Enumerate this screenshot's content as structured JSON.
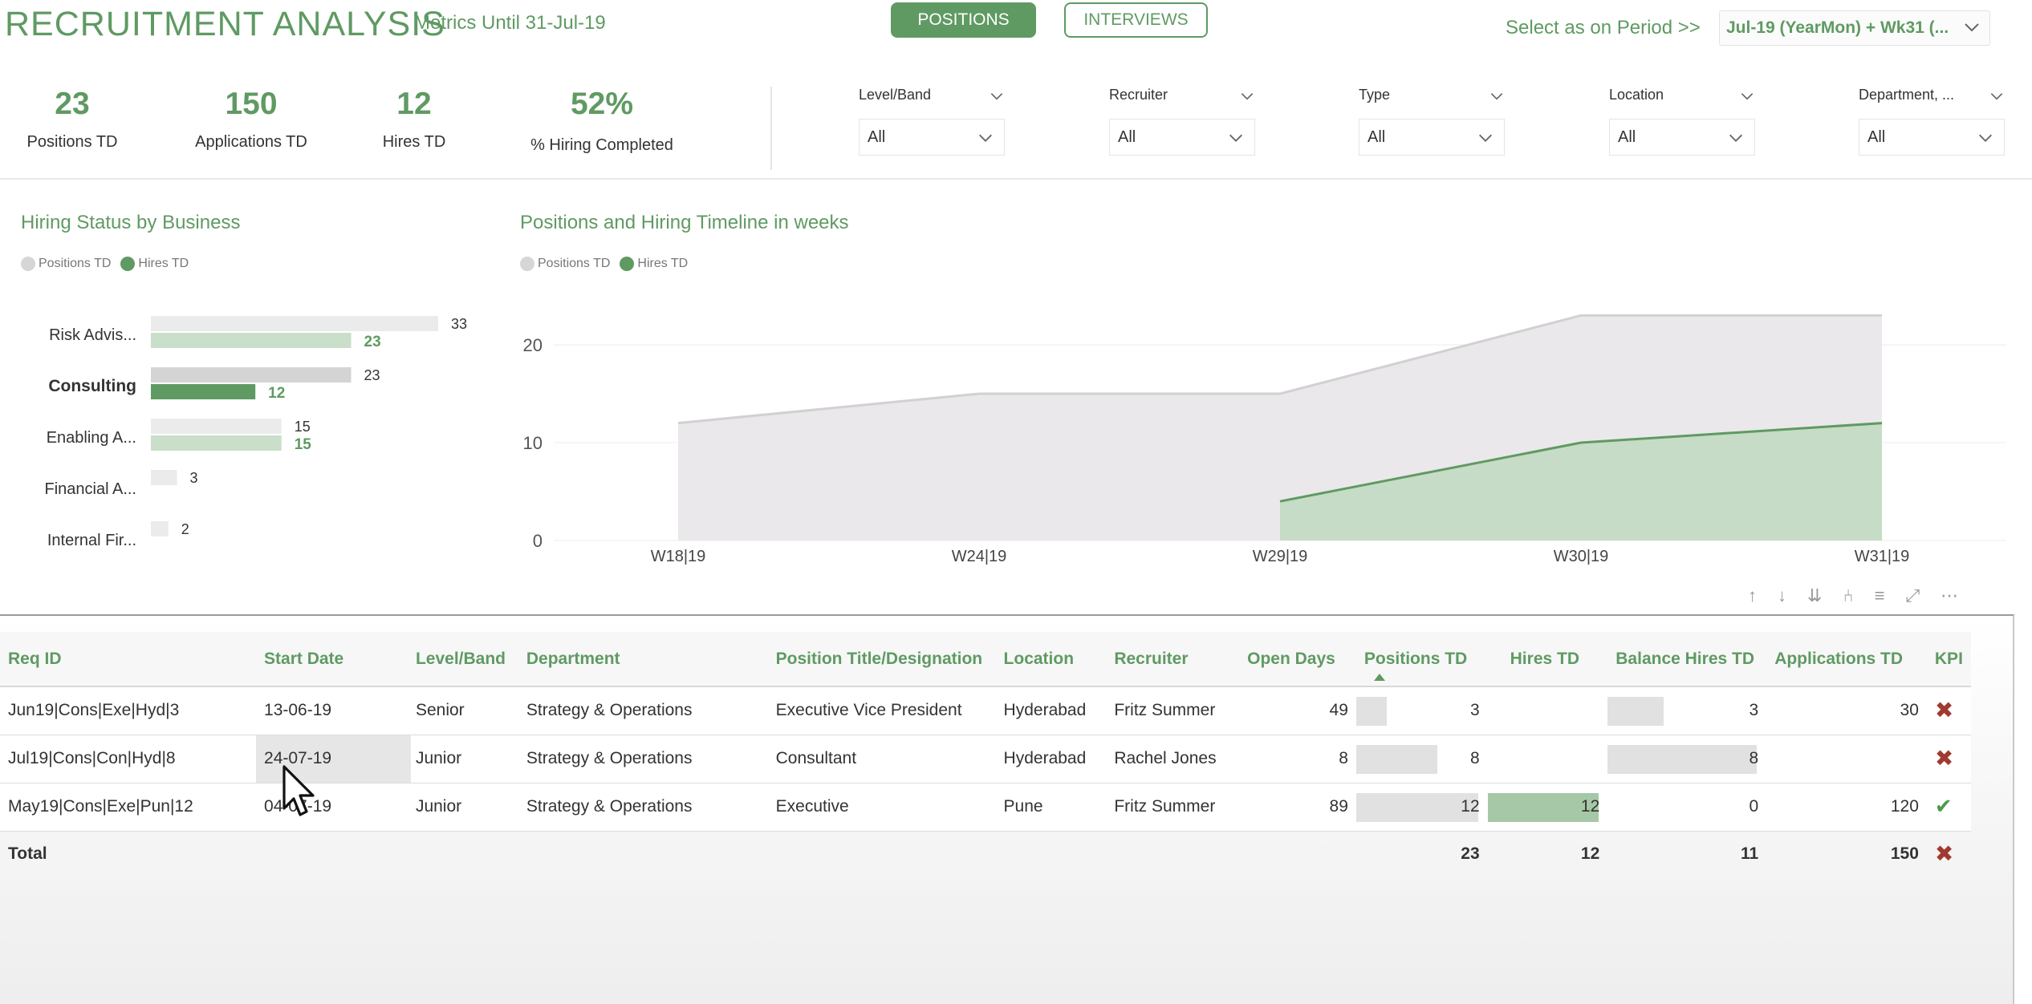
{
  "header": {
    "title": "RECRUITMENT ANALYSIS",
    "subtitle": "Metrics Until 31-Jul-19",
    "tabs": [
      {
        "label": "POSITIONS",
        "active": true
      },
      {
        "label": "INTERVIEWS",
        "active": false
      }
    ],
    "period_label": "Select as on Period >>",
    "period_value": "Jul-19 (YearMon) + Wk31 (..."
  },
  "kpis": [
    {
      "value": "23",
      "label": "Positions TD"
    },
    {
      "value": "150",
      "label": "Applications TD"
    },
    {
      "value": "12",
      "label": "Hires TD"
    },
    {
      "value": "52%",
      "label": "% Hiring Completed"
    }
  ],
  "filters": [
    {
      "label": "Level/Band",
      "value": "All"
    },
    {
      "label": "Recruiter",
      "value": "All"
    },
    {
      "label": "Type",
      "value": "All"
    },
    {
      "label": "Location",
      "value": "All"
    },
    {
      "label": "Department, ...",
      "value": "All"
    }
  ],
  "legend": {
    "positions": "Positions TD",
    "hires": "Hires TD"
  },
  "colors": {
    "accent": "#5f9a62",
    "positions_bar": "#ebebeb",
    "hires_bar": "#c9dfc9",
    "hires_bar_selected": "#5f9a62",
    "kpi_fail": "#a03a30",
    "kpi_pass": "#4c9a4c"
  },
  "chart_data": [
    {
      "type": "bar",
      "title": "Hiring Status by Business",
      "orientation": "horizontal",
      "categories": [
        "Risk Advis...",
        "Consulting",
        "Enabling A...",
        "Financial A...",
        "Internal Fir..."
      ],
      "selected_category": "Consulting",
      "series": [
        {
          "name": "Positions TD",
          "values": [
            33,
            23,
            15,
            3,
            2
          ]
        },
        {
          "name": "Hires TD",
          "values": [
            23,
            12,
            15,
            null,
            null
          ]
        }
      ],
      "legend": "top-left"
    },
    {
      "type": "area",
      "title": "Positions and Hiring Timeline in weeks",
      "x": [
        "W18|19",
        "W24|19",
        "W29|19",
        "W30|19",
        "W31|19"
      ],
      "series": [
        {
          "name": "Positions TD",
          "values": [
            12,
            15,
            15,
            23,
            23
          ]
        },
        {
          "name": "Hires TD",
          "values": [
            null,
            null,
            4,
            10,
            12
          ]
        }
      ],
      "yticks": [
        "0",
        "10",
        "20"
      ],
      "ylim": [
        0,
        23
      ],
      "grid": true,
      "legend": "top-left"
    }
  ],
  "table": {
    "columns": [
      "Req ID",
      "Start Date",
      "Level/Band",
      "Department",
      "Position Title/Designation",
      "Location",
      "Recruiter",
      "Open Days",
      "Positions TD",
      "Hires TD",
      "Balance Hires TD",
      "Applications TD",
      "KPI"
    ],
    "rows": [
      {
        "req_id": "Jun19|Cons|Exe|Hyd|3",
        "start_date": "13-06-19",
        "level": "Senior",
        "department": "Strategy & Operations",
        "position": "Executive Vice President",
        "location": "Hyderabad",
        "recruiter": "Fritz Summer",
        "open_days": "49",
        "positions_td": "3",
        "positions_frac": 0.25,
        "hires_td": "",
        "hires_frac": 0,
        "balance": "3",
        "balance_frac": 0.375,
        "applications": "30",
        "kpi": "fail"
      },
      {
        "req_id": "Jul19|Cons|Con|Hyd|8",
        "start_date": "24-07-19",
        "level": "Junior",
        "department": "Strategy & Operations",
        "position": "Consultant",
        "location": "Hyderabad",
        "recruiter": "Rachel Jones",
        "open_days": "8",
        "positions_td": "8",
        "positions_frac": 0.667,
        "hires_td": "",
        "hires_frac": 0,
        "balance": "8",
        "balance_frac": 1.0,
        "applications": "",
        "kpi": "fail"
      },
      {
        "req_id": "May19|Cons|Exe|Pun|12",
        "start_date": "04-07-19",
        "level": "Junior",
        "department": "Strategy & Operations",
        "position": "Executive",
        "location": "Pune",
        "recruiter": "Fritz Summer",
        "open_days": "89",
        "positions_td": "12",
        "positions_frac": 1.0,
        "hires_td": "12",
        "hires_frac": 1.0,
        "balance": "0",
        "balance_frac": 0,
        "applications": "120",
        "kpi": "pass"
      }
    ],
    "total": {
      "label": "Total",
      "positions_td": "23",
      "hires_td": "12",
      "balance": "11",
      "applications": "150",
      "kpi": "fail"
    }
  }
}
